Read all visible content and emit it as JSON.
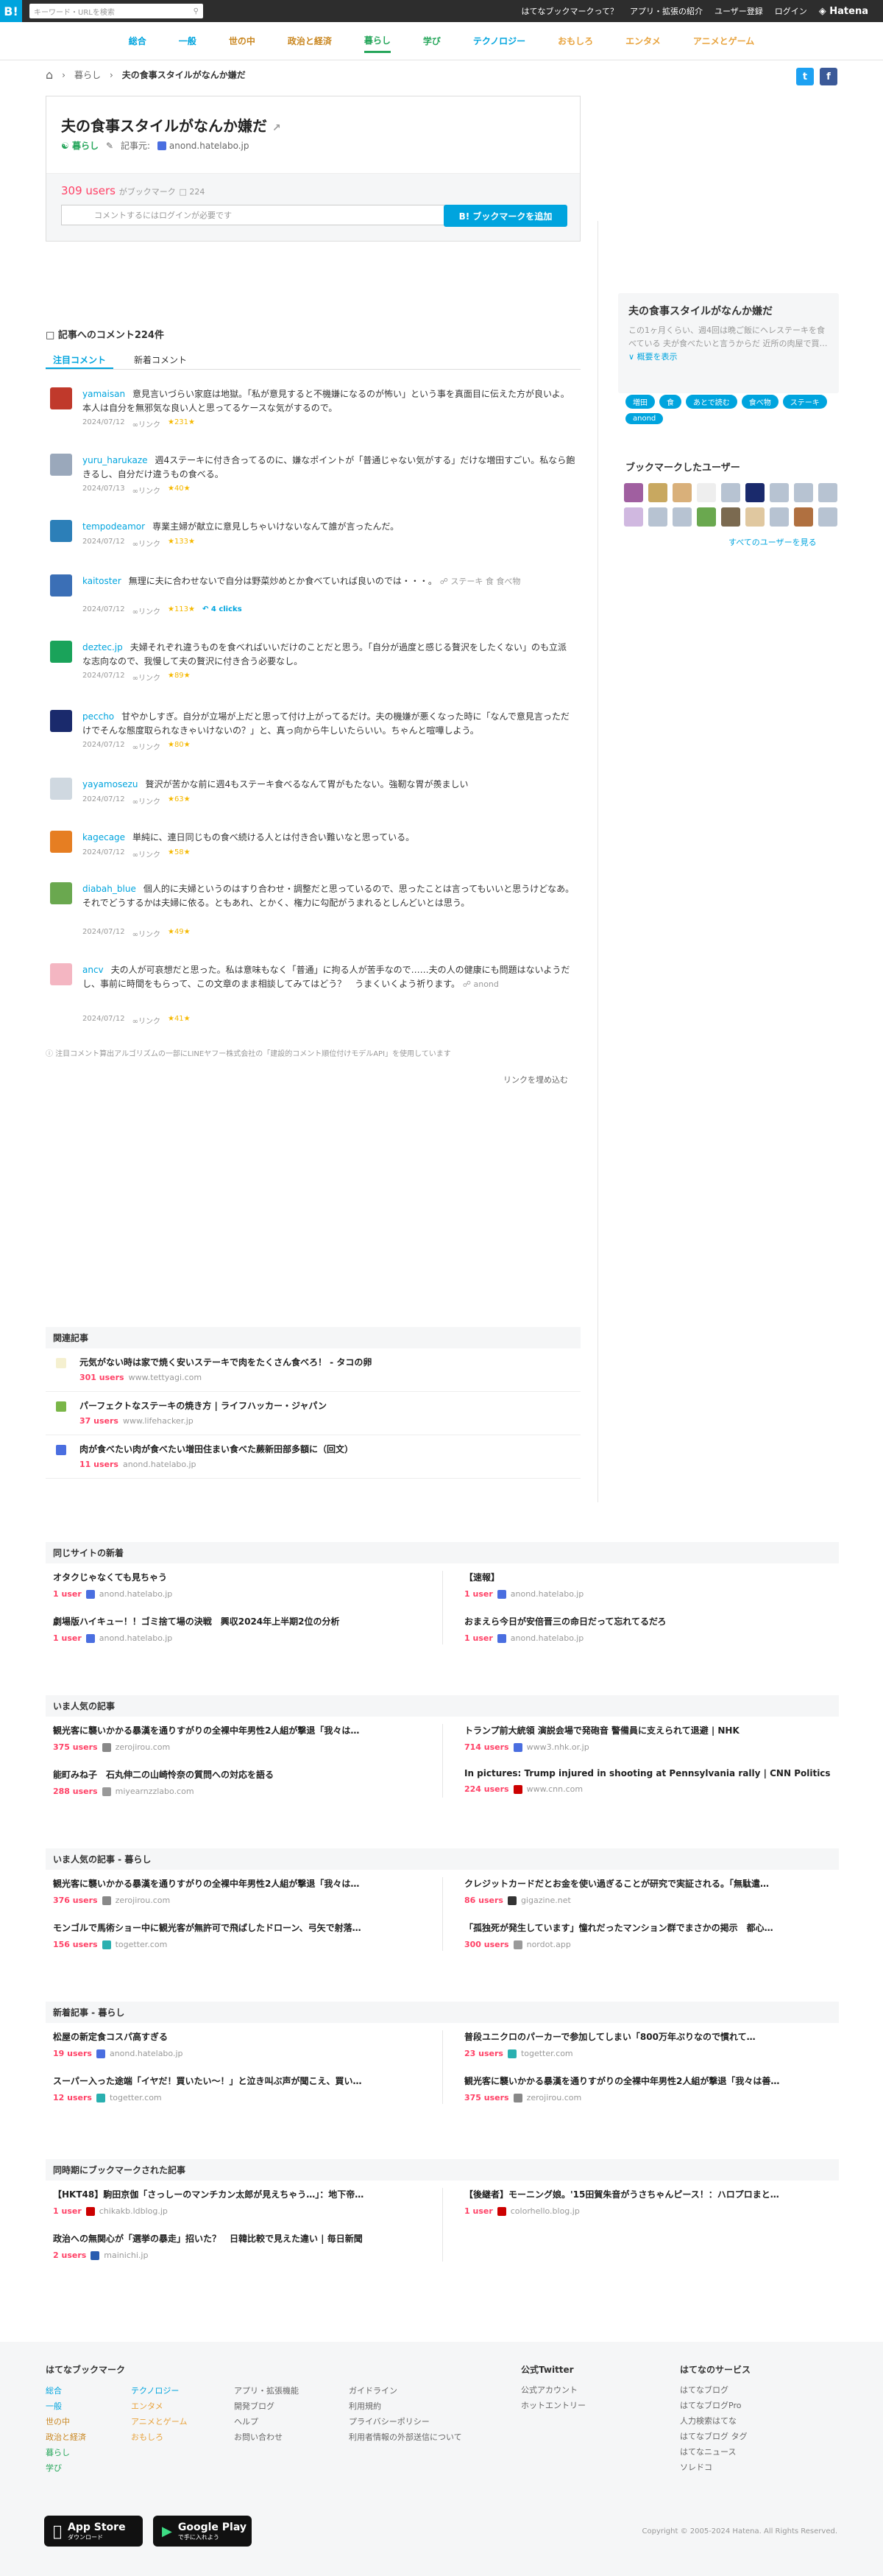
{
  "topbar": {
    "logo": "B!",
    "search_placeholder": "キーワード・URLを検索",
    "links": [
      "はてなブックマークって？",
      "アプリ・拡張の紹介",
      "ユーザー登録",
      "ログイン"
    ],
    "brand": "Hatena"
  },
  "categories": [
    {
      "label": "総合",
      "color": "#00a4de"
    },
    {
      "label": "一般",
      "color": "#00a4de"
    },
    {
      "label": "世の中",
      "color": "#c9861f"
    },
    {
      "label": "政治と経済",
      "color": "#c9861f"
    },
    {
      "label": "暮らし",
      "color": "#26a65b"
    },
    {
      "label": "学び",
      "color": "#26a65b"
    },
    {
      "label": "テクノロジー",
      "color": "#00a4de"
    },
    {
      "label": "おもしろ",
      "color": "#e8a33d"
    },
    {
      "label": "エンタメ",
      "color": "#e8a33d"
    },
    {
      "label": "アニメとゲーム",
      "color": "#e8a33d"
    }
  ],
  "breadcrumb": {
    "category": "暮らし",
    "current": "夫の食事スタイルがなんか嫌だ"
  },
  "entry": {
    "title": "夫の食事スタイルがなんか嫌だ",
    "category": "暮らし",
    "source_label": "記事元:",
    "domain": "anond.hatelabo.jp",
    "users": "309 users",
    "bookmarked": "がブックマーク",
    "comment_count": "224",
    "comment_placeholder": "コメントするにはログインが必要です",
    "add_button": "B! ブックマークを追加"
  },
  "sidebar": {
    "title": "夫の食事スタイルがなんか嫌だ",
    "summary": "この1ヶ月くらい、週4回は晩ご飯にヘレステーキを食べている 夫が食べたいと言うからだ 近所の肉屋で買…",
    "summary_more": "概要を表示",
    "tags": [
      "増田",
      "食",
      "あとで読む",
      "食べ物",
      "ステーキ",
      "anond"
    ],
    "bm_title": "ブックマークしたユーザー",
    "all_users": "すべてのユーザーを見る"
  },
  "comments_section": {
    "heading": "記事へのコメント224件",
    "tab_popular": "注目コメント",
    "tab_new": "新着コメント"
  },
  "comments": [
    {
      "user": "yamaisan",
      "text": "意見言いづらい家庭は地獄。「私が意見すると不機嫌になるのが怖い」という事を真面目に伝えた方が良いよ。本人は自分を無邪気な良い人と思ってるケースな気がするので。",
      "date": "2024/07/12",
      "link": "∞リンク",
      "stars": "★231★",
      "avatar": "#c0392b"
    },
    {
      "user": "yuru_harukaze",
      "text": "週4ステーキに付き合ってるのに、嫌なポイントが「普通じゃない気がする」だけな増田すごい。私なら飽きるし、自分だけ違うもの食べる。",
      "date": "2024/07/13",
      "link": "∞リンク",
      "stars": "★40★",
      "avatar": "#9aa8bb"
    },
    {
      "user": "tempodeamor",
      "text": "専業主婦が献立に意見しちゃいけないなんて誰が言ったんだ。",
      "date": "2024/07/12",
      "link": "∞リンク",
      "stars": "★133★",
      "avatar": "#2c7fb8"
    },
    {
      "user": "kaitoster",
      "text": "無理に夫に合わせないで自分は野菜炒めとか食べていれば良いのでは・・・。",
      "tags": "ステーキ 食 食べ物",
      "date": "2024/07/12",
      "link": "∞リンク",
      "stars": "★113★",
      "clicks": "4 clicks",
      "avatar": "#3b6fb6"
    },
    {
      "user": "deztec.jp",
      "text": "夫婦それぞれ違うものを食べればいいだけのことだと思う。「自分が過度と感じる贅沢をしたくない」のも立派な志向なので、我慢して夫の贅沢に付き合う必要なし。",
      "date": "2024/07/12",
      "link": "∞リンク",
      "stars": "★89★",
      "avatar": "#1aa35a"
    },
    {
      "user": "peccho",
      "text": "甘やかしすぎ。自分が立場が上だと思って付け上がってるだけ。夫の機嫌が悪くなった時に「なんで意見言っただけでそんな態度取られなきゃいけないの？」と、真っ向から牛しいたらいい。ちゃんと喧嘩しよう。",
      "date": "2024/07/12",
      "link": "∞リンク",
      "stars": "★80★",
      "avatar": "#1a2a6c"
    },
    {
      "user": "yayamosezu",
      "text": "贅沢が苦かな前に週4もステーキ食べるなんて胃がもたない。強靭な胃が羨ましい",
      "date": "2024/07/12",
      "link": "∞リンク",
      "stars": "★63★",
      "avatar": "#cfd8e0"
    },
    {
      "user": "kagecage",
      "text": "単純に、連日同じもの食べ続ける人とは付き合い難いなと思っている。",
      "date": "2024/07/12",
      "link": "∞リンク",
      "stars": "★58★",
      "avatar": "#e67e22"
    },
    {
      "user": "diabah_blue",
      "text": "個人的に夫婦というのはすり合わせ・調整だと思っているので、思ったことは言ってもいいと思うけどなあ。それでどうするかは夫婦に依る。ともあれ、とかく、権力に勾配がうまれるとしんどいとは思う。",
      "date": "2024/07/12",
      "link": "∞リンク",
      "stars": "★49★",
      "avatar": "#6aa84f"
    },
    {
      "user": "ancv",
      "text": "夫の人が可哀想だと思った。私は意味もなく「普通」に拘る人が苦手なので……夫の人の健康にも問題はないようだし、事前に時間をもらって、この文章のまま相談してみてはどう？　うまくいくよう祈ります。",
      "tags": "anond",
      "date": "2024/07/12",
      "link": "∞リンク",
      "stars": "★41★",
      "avatar": "#f4b6c2"
    }
  ],
  "comments_note": "注目コメント算出アルゴリズムの一部にLINEヤフー株式会社の「建設的コメント順位付けモデルAPI」を使用しています",
  "embed_link": "リンクを埋め込む",
  "related": {
    "heading": "関連記事",
    "items": [
      {
        "title": "元気がない時は家で焼く安いステーキで肉をたくさん食べろ！ - タコの卵",
        "users": "301 users",
        "domain": "www.tettyagi.com",
        "color": "#f5f0d0"
      },
      {
        "title": "パーフェクトなステーキの焼き方 | ライフハッカー・ジャパン",
        "users": "37 users",
        "domain": "www.lifehacker.jp",
        "color": "#7ab648"
      },
      {
        "title": "肉が食べたい肉が食べたい増田住まい食べた蕨新田部多額に（回文）",
        "users": "11 users",
        "domain": "anond.hatelabo.jp",
        "color": "#4a6ee0"
      }
    ]
  },
  "same_site": {
    "heading": "同じサイトの新着",
    "items": [
      {
        "title": "オタクじゃなくても見ちゃう",
        "users": "1 user",
        "domain": "anond.hatelabo.jp",
        "color": "#4a6ee0"
      },
      {
        "title": "【速報】",
        "users": "1 user",
        "domain": "anond.hatelabo.jp",
        "color": "#4a6ee0"
      },
      {
        "title": "劇場版ハイキュー！！ゴミ捨て場の決戦　興収2024年上半期2位の分析",
        "users": "1 user",
        "domain": "anond.hatelabo.jp",
        "color": "#4a6ee0"
      },
      {
        "title": "おまえら今日が安倍晋三の命日だって忘れてるだろ",
        "users": "1 user",
        "domain": "anond.hatelabo.jp",
        "color": "#4a6ee0"
      }
    ]
  },
  "popular": {
    "heading": "いま人気の記事",
    "items": [
      {
        "title": "観光客に襲いかかる暴漢を通りすがりの全裸中年男性2人組が撃退「我々は…",
        "users": "375 users",
        "domain": "zerojirou.com",
        "color": "#888"
      },
      {
        "title": "トランプ前大統領 演説会場で発砲音 警備員に支えられて退避 | NHK",
        "users": "714 users",
        "domain": "www3.nhk.or.jp",
        "color": "#4a6ee0"
      },
      {
        "title": "能町みね子　石丸伸二の山崎怜奈の質問への対応を語る",
        "users": "288 users",
        "domain": "miyearnzzlabo.com",
        "color": "#999"
      },
      {
        "title": "In pictures: Trump injured in shooting at Pennsylvania rally | CNN Politics",
        "users": "224 users",
        "domain": "www.cnn.com",
        "color": "#cc0000"
      }
    ]
  },
  "popular_life": {
    "heading": "いま人気の記事 - 暮らし",
    "items": [
      {
        "title": "観光客に襲いかかる暴漢を通りすがりの全裸中年男性2人組が撃退「我々は…",
        "users": "376 users",
        "domain": "zerojirou.com",
        "color": "#888"
      },
      {
        "title": "クレジットカードだとお金を使い過ぎることが研究で実証される。「無駄遣…",
        "users": "86 users",
        "domain": "gigazine.net",
        "color": "#333"
      },
      {
        "title": "モンゴルで馬術ショー中に観光客が無許可で飛ばしたドローン、弓矢で射落…",
        "users": "156 users",
        "domain": "togetter.com",
        "color": "#2ab0b0"
      },
      {
        "title": "「孤独死が発生しています」憧れだったマンション群でまさかの掲示　都心…",
        "users": "300 users",
        "domain": "nordot.app",
        "color": "#999"
      }
    ]
  },
  "new_life": {
    "heading": "新着記事 - 暮らし",
    "items": [
      {
        "title": "松屋の新定食コスパ高すぎる",
        "users": "19 users",
        "domain": "anond.hatelabo.jp",
        "color": "#4a6ee0"
      },
      {
        "title": "普段ユニクロのパーカーで参加してしまい「800万年ぶりなので慣れて…",
        "users": "23 users",
        "domain": "togetter.com",
        "color": "#2ab0b0"
      },
      {
        "title": "スーパー入った途端「イヤだ！買いたい〜！」と泣き叫ぶ声が聞こえ、買い…",
        "users": "12 users",
        "domain": "togetter.com",
        "color": "#2ab0b0"
      },
      {
        "title": "観光客に襲いかかる暴漢を通りすがりの全裸中年男性2人組が撃退「我々は善…",
        "users": "375 users",
        "domain": "zerojirou.com",
        "color": "#888"
      }
    ]
  },
  "same_time": {
    "heading": "同時期にブックマークされた記事",
    "items": [
      {
        "title": "【HKT48】駒田京伽「さっしーのマンチカン太郎が見えちゃう…」：地下帝…",
        "users": "1 user",
        "domain": "chikakb.ldblog.jp",
        "color": "#cc0000"
      },
      {
        "title": "【後継者】モーニング娘。'15田賀朱音がうさちゃんピース！：ハロプロまと…",
        "users": "1 user",
        "domain": "colorhello.blog.jp",
        "color": "#cc0000"
      },
      {
        "title": "政治への無関心が「選挙の暴走」招いた？　日韓比較で見えた違い | 毎日新聞",
        "users": "2 users",
        "domain": "mainichi.jp",
        "color": "#2a5db0"
      }
    ]
  },
  "footer": {
    "col1_head": "はてなブックマーク",
    "col1a": [
      "総合",
      "一般",
      "世の中",
      "政治と経済",
      "暮らし",
      "学び"
    ],
    "col1b": [
      "テクノロジー",
      "エンタメ",
      "アニメとゲーム",
      "おもしろ"
    ],
    "col2": [
      "アプリ・拡張機能",
      "開発ブログ",
      "ヘルプ",
      "お問い合わせ"
    ],
    "col3": [
      "ガイドライン",
      "利用規約",
      "プライバシーポリシー",
      "利用者情報の外部送信について"
    ],
    "col4_head": "公式Twitter",
    "col4": [
      "公式アカウント",
      "ホットエントリー"
    ],
    "col5_head": "はてなのサービス",
    "col5": [
      "はてなブログ",
      "はてなブログPro",
      "人力検索はてな",
      "はてなブログ タグ",
      "はてなニュース",
      "ソレドコ"
    ],
    "appstore_small": "ダウンロード",
    "appstore": "App Store",
    "googleplay_small": "で手に入れよう",
    "googleplay": "Google Play",
    "copyright": "Copyright © 2005-2024 Hatena. All Rights Reserved."
  }
}
